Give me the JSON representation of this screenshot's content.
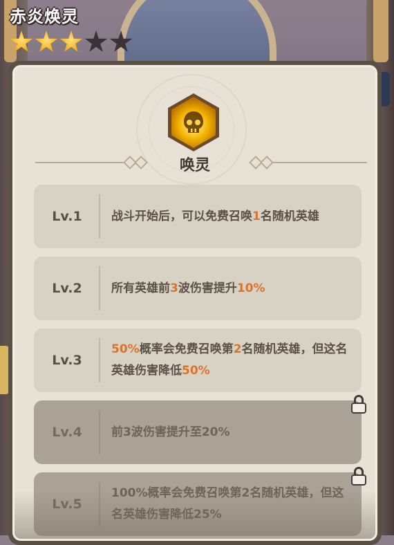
{
  "hero": {
    "name": "赤炎焕灵",
    "stars_total": 5,
    "stars_filled": 3
  },
  "skill": {
    "name": "唤灵",
    "icon": "flame-skull-icon"
  },
  "levels": [
    {
      "label": "Lv.1",
      "locked": false,
      "parts": [
        {
          "t": "战斗开始后，可以免费召唤"
        },
        {
          "t": "1",
          "hl": true
        },
        {
          "t": "名随机英雄"
        }
      ]
    },
    {
      "label": "Lv.2",
      "locked": false,
      "parts": [
        {
          "t": "所有英雄前"
        },
        {
          "t": "3",
          "hl": true
        },
        {
          "t": "波伤害提升"
        },
        {
          "t": "10%",
          "hl": true
        }
      ]
    },
    {
      "label": "Lv.3",
      "locked": false,
      "parts": [
        {
          "t": "50%",
          "hl": true
        },
        {
          "t": "概率会免费召唤第"
        },
        {
          "t": "2",
          "hl": true
        },
        {
          "t": "名随机英雄，但这名英雄伤害降低"
        },
        {
          "t": "50%",
          "hl": true
        }
      ]
    },
    {
      "label": "Lv.4",
      "locked": true,
      "parts": [
        {
          "t": "前3波伤害提升至20%"
        }
      ]
    },
    {
      "label": "Lv.5",
      "locked": true,
      "parts": [
        {
          "t": "100%概率会免费召唤第2名随机英雄，但这名英雄伤害降低25%"
        }
      ]
    }
  ],
  "colors": {
    "highlight": "#d9742c",
    "panel_bg": "#e8e2d6",
    "row_bg": "#d8d2c5",
    "row_locked_bg": "#aaa296"
  }
}
